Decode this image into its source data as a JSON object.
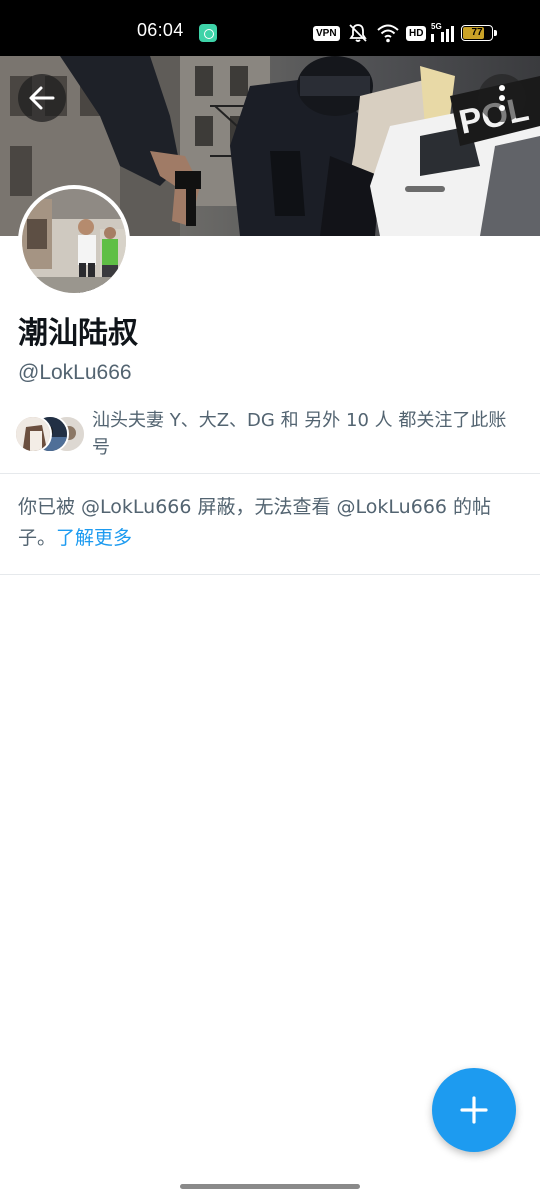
{
  "status_bar": {
    "time": "06:04",
    "vpn_label": "VPN",
    "hd_label": "HD",
    "network_label": "5G",
    "battery_level": "77",
    "battery_fraction": 0.77,
    "battery_color": "#c9a227"
  },
  "header": {
    "back_icon": "arrow-left-icon",
    "more_icon": "more-vertical-icon"
  },
  "profile": {
    "display_name": "潮汕陆叔",
    "handle": "@LokLu666"
  },
  "followers": {
    "text": "汕头夫妻 Y、大Z、DG 和 另外 10 人 都关注了此账号"
  },
  "blocked": {
    "text": "你已被 @LokLu666 屏蔽，无法查看 @LokLu666 的帖子。",
    "learn_more": "了解更多"
  },
  "fab": {
    "icon": "plus-icon",
    "color": "#1d9bf0"
  }
}
